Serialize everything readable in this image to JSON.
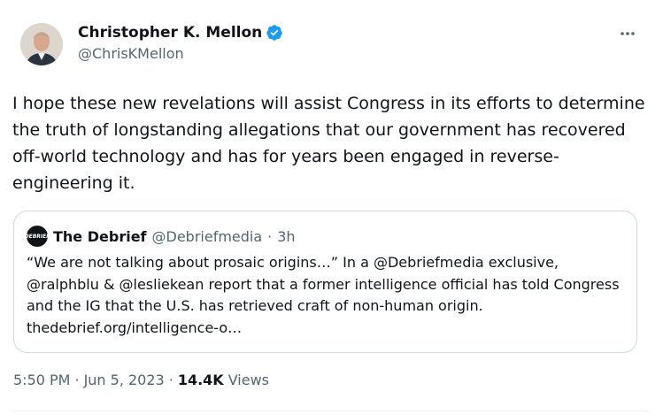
{
  "author": {
    "display_name": "Christopher K. Mellon",
    "handle": "@ChrisKMellon",
    "verified_icon": "verified-badge-icon",
    "avatar_icon": "avatar"
  },
  "more_icon": "more-icon",
  "post": {
    "text": "I hope these new revelations will assist Congress in its efforts to determine the truth of longstanding allegations that our government has recovered off-world technology and has for years been engaged in reverse-engineering it."
  },
  "quote": {
    "avatar_text": "DEBRIEF",
    "name": "The Debrief",
    "handle": "@Debriefmedia",
    "dot": "·",
    "time": "3h",
    "text": "“We are not talking about prosaic origins…” In a @Debriefmedia exclusive, @ralphblu & @lesliekean report that a former intelligence official has told Congress and the IG that the U.S. has retrieved craft of non-human origin. thedebrief.org/intelligence-o…"
  },
  "meta": {
    "time": "5:50 PM",
    "sep1": "·",
    "date": "Jun 5, 2023",
    "sep2": "·",
    "views_count": "14.4K",
    "views_label": "Views"
  },
  "colors": {
    "text": "#0f1419",
    "secondary": "#536471",
    "verified": "#1d9bf0",
    "border": "#cfd9de"
  }
}
